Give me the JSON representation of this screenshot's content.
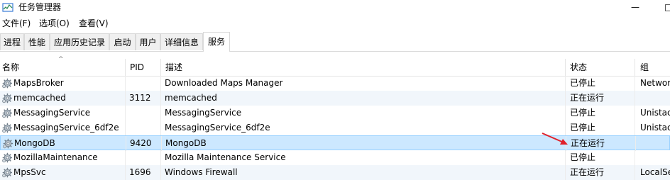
{
  "window": {
    "title": "任务管理器",
    "controls": [
      "—",
      "□"
    ]
  },
  "menu": [
    "文件(F)",
    "选项(O)",
    "查看(V)"
  ],
  "tabs": [
    "进程",
    "性能",
    "应用历史记录",
    "启动",
    "用户",
    "详细信息",
    "服务"
  ],
  "active_tab": "服务",
  "columns": {
    "name": "名称",
    "pid": "PID",
    "desc": "描述",
    "status": "状态",
    "group": "组"
  },
  "sort_indicator": "^",
  "rows": [
    {
      "name": "MapsBroker",
      "pid": "",
      "desc": "Downloaded Maps Manager",
      "status": "已停止",
      "group": "Networ"
    },
    {
      "name": "memcached",
      "pid": "3112",
      "desc": "memcached",
      "status": "正在运行",
      "group": ""
    },
    {
      "name": "MessagingService",
      "pid": "",
      "desc": "MessagingService",
      "status": "已停止",
      "group": "Unistac"
    },
    {
      "name": "MessagingService_6df2e",
      "pid": "",
      "desc": "MessagingService_6df2e",
      "status": "已停止",
      "group": "Unistac"
    },
    {
      "name": "MongoDB",
      "pid": "9420",
      "desc": "MongoDB",
      "status": "正在运行",
      "group": ""
    },
    {
      "name": "MozillaMaintenance",
      "pid": "",
      "desc": "Mozilla Maintenance Service",
      "status": "已停止",
      "group": ""
    },
    {
      "name": "MpsSvc",
      "pid": "1696",
      "desc": "Windows Firewall",
      "status": "正在运行",
      "group": "LocalSe"
    }
  ],
  "selected_row": "MongoDB",
  "colors": {
    "selection_bg": "#cce8ff",
    "selection_border": "#99d1ff",
    "running_row_bg": "#f1f6fb",
    "annotation_arrow": "#e0202a"
  },
  "icons": {
    "app": "task-manager-icon",
    "service": "gear-icon"
  }
}
